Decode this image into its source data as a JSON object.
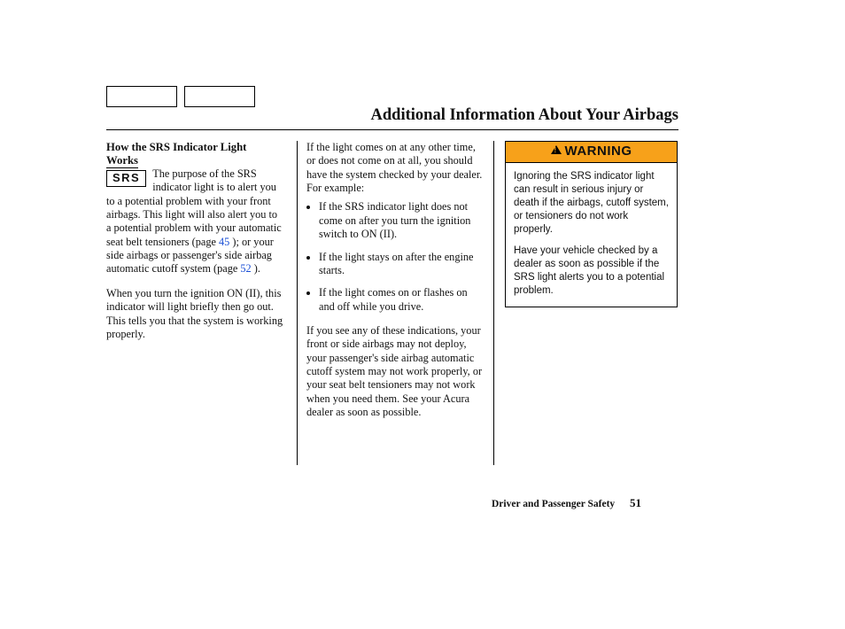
{
  "title": "Additional Information About Your Airbags",
  "nav": {
    "box1": "",
    "box2": ""
  },
  "col1": {
    "subhead_line1": "How the SRS Indicator Light",
    "subhead_line2": "Works",
    "srs_badge": "SRS",
    "p1_a": "The purpose of the SRS indicator light is to alert you to a potential problem with your front airbags. This light will also alert you to a potential problem with your automatic seat belt tensioners (page ",
    "p1_link1": "45",
    "p1_b": " ); or your side airbags or passenger's side airbag automatic cutoff system (page ",
    "p1_link2": "52",
    "p1_c": " ).",
    "p2": "When you turn the ignition ON (II), this indicator will light briefly then go out. This tells you that the system is working properly."
  },
  "col2": {
    "p1": "If the light comes on at any other time, or does not come on at all, you should have the system checked by your dealer. For example:",
    "b1": "If the SRS indicator light does not come on after you turn the ignition switch to ON (II).",
    "b2": "If the light stays on after the engine starts.",
    "b3": "If the light comes on or flashes on and off while you drive.",
    "p2": "If you see any of these indications, your front or side airbags may not deploy, your passenger's side airbag automatic cutoff system may not work properly, or your seat belt tensioners may not work when you need them. See your Acura dealer as soon as possible."
  },
  "warning": {
    "label": "WARNING",
    "p1": "Ignoring the SRS indicator light can result in serious injury or death if the airbags, cutoff system, or tensioners do not work properly.",
    "p2": "Have your vehicle checked by a dealer as soon as possible if the SRS light alerts you to a potential problem."
  },
  "footer": {
    "section": "Driver and Passenger Safety",
    "page": "51"
  }
}
